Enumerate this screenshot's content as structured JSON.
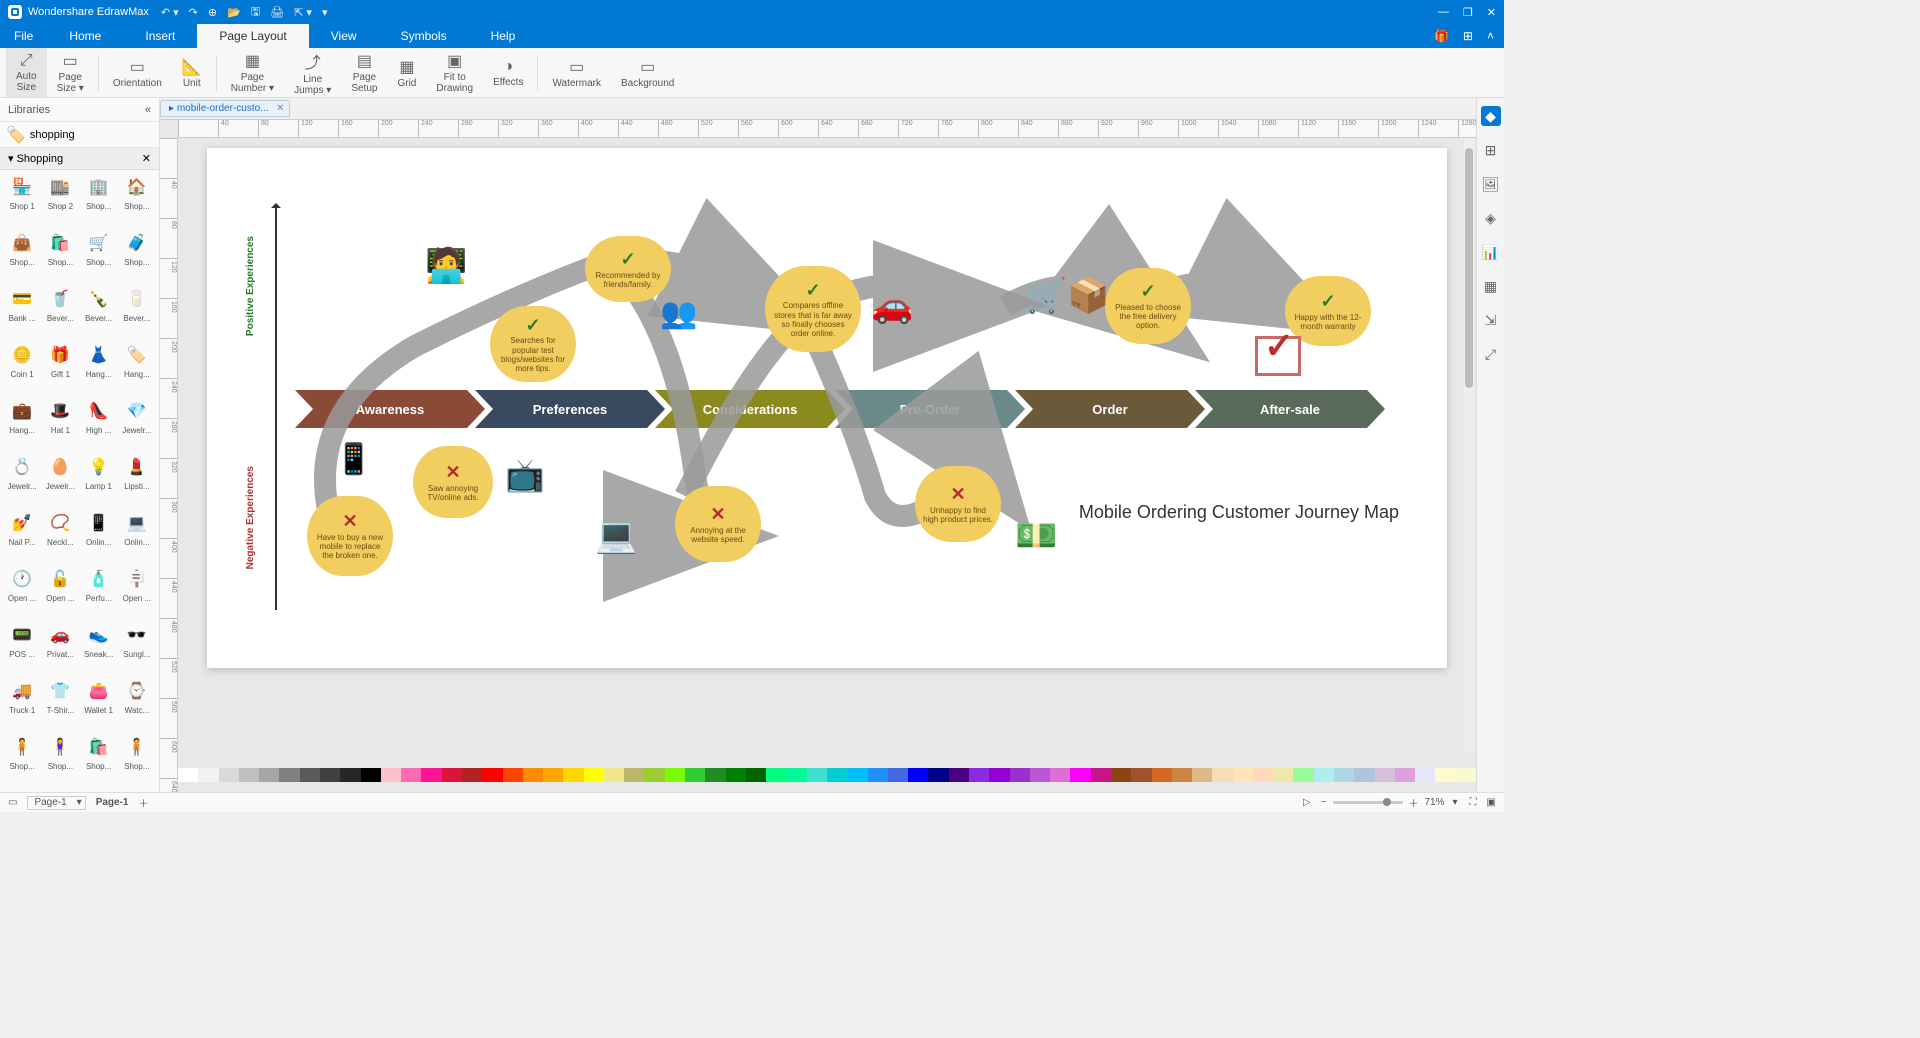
{
  "app": {
    "title": "Wondershare EdrawMax"
  },
  "menu": {
    "file": "File",
    "items": [
      "Home",
      "Insert",
      "Page Layout",
      "View",
      "Symbols",
      "Help"
    ],
    "active": 2
  },
  "ribbon": [
    {
      "label": "Auto\nSize",
      "icon": "⤢"
    },
    {
      "label": "Page\nSize ▾",
      "icon": "▭"
    },
    {
      "label": "Orientation",
      "icon": "▭"
    },
    {
      "label": "Unit",
      "icon": "▲"
    },
    {
      "label": "Page\nNumber ▾",
      "icon": "▦"
    },
    {
      "label": "Line\nJumps ▾",
      "icon": "⤴"
    },
    {
      "label": "Page\nSetup",
      "icon": "▤"
    },
    {
      "label": "Grid",
      "icon": "▦"
    },
    {
      "label": "Fit to\nDrawing",
      "icon": "▣"
    },
    {
      "label": "Effects",
      "icon": "◑"
    },
    {
      "label": "Watermark",
      "icon": "▭"
    },
    {
      "label": "Background",
      "icon": "▭"
    }
  ],
  "libraries": {
    "header": "Libraries",
    "search_value": "shopping",
    "category": "Shopping",
    "items": [
      {
        "l": "Shop 1",
        "e": "🏪"
      },
      {
        "l": "Shop 2",
        "e": "🏬"
      },
      {
        "l": "Shop...",
        "e": "🏢"
      },
      {
        "l": "Shop...",
        "e": "🏠"
      },
      {
        "l": "Shop...",
        "e": "👜"
      },
      {
        "l": "Shop...",
        "e": "🛍️"
      },
      {
        "l": "Shop...",
        "e": "🛒"
      },
      {
        "l": "Shop...",
        "e": "🧳"
      },
      {
        "l": "Bank ...",
        "e": "💳"
      },
      {
        "l": "Bever...",
        "e": "🥤"
      },
      {
        "l": "Bever...",
        "e": "🍾"
      },
      {
        "l": "Bever...",
        "e": "🥛"
      },
      {
        "l": "Coin 1",
        "e": "🪙"
      },
      {
        "l": "Gift 1",
        "e": "🎁"
      },
      {
        "l": "Hang...",
        "e": "👗"
      },
      {
        "l": "Hang...",
        "e": "🏷️"
      },
      {
        "l": "Hang...",
        "e": "💼"
      },
      {
        "l": "Hat 1",
        "e": "🎩"
      },
      {
        "l": "High ...",
        "e": "👠"
      },
      {
        "l": "Jewelr...",
        "e": "💎"
      },
      {
        "l": "Jewelr...",
        "e": "💍"
      },
      {
        "l": "Jewelr...",
        "e": "🥚"
      },
      {
        "l": "Lamp 1",
        "e": "💡"
      },
      {
        "l": "Lipsti...",
        "e": "💄"
      },
      {
        "l": "Nail P...",
        "e": "💅"
      },
      {
        "l": "Neckl...",
        "e": "📿"
      },
      {
        "l": "Onlin...",
        "e": "📱"
      },
      {
        "l": "Onlin...",
        "e": "💻"
      },
      {
        "l": "Open ...",
        "e": "🕐"
      },
      {
        "l": "Open ...",
        "e": "🔓"
      },
      {
        "l": "Perfu...",
        "e": "🧴"
      },
      {
        "l": "Open ...",
        "e": "🪧"
      },
      {
        "l": "POS ...",
        "e": "📟"
      },
      {
        "l": "Privat...",
        "e": "🚗"
      },
      {
        "l": "Sneak...",
        "e": "👟"
      },
      {
        "l": "Sungl...",
        "e": "🕶️"
      },
      {
        "l": "Truck 1",
        "e": "🚚"
      },
      {
        "l": "T-Shir...",
        "e": "👕"
      },
      {
        "l": "Wallet 1",
        "e": "👛"
      },
      {
        "l": "Watc...",
        "e": "⌚"
      },
      {
        "l": "Shop...",
        "e": "🧍"
      },
      {
        "l": "Shop...",
        "e": "🧍‍♀️"
      },
      {
        "l": "Shop...",
        "e": "🛍️"
      },
      {
        "l": "Shop...",
        "e": "🧍"
      }
    ]
  },
  "tab": {
    "name": "mobile-order-custo..."
  },
  "diagram": {
    "title": "Mobile Ordering Customer Journey Map",
    "axis_pos": "Positive\nExperiences",
    "axis_neg": "Negative\nExperiences",
    "stages": [
      {
        "label": "Awareness",
        "color": "#8a4a36"
      },
      {
        "label": "Preferences",
        "color": "#3a4a5e"
      },
      {
        "label": "Considerations",
        "color": "#8a8a1e"
      },
      {
        "label": "Pre-Order",
        "color": "#6a8a8a"
      },
      {
        "label": "Order",
        "color": "#6a5a3a"
      },
      {
        "label": "After-sale",
        "color": "#5a6a5a"
      }
    ],
    "pos_bubbles": [
      {
        "text": "Searches for popular test blogs/websites for more tips."
      },
      {
        "text": "Recommended by friends/family."
      },
      {
        "text": "Compares offline stores that is far away so finally chooses order online."
      },
      {
        "text": "Pleased to choose the free delivery option."
      },
      {
        "text": "Happy with the 12-month warranty"
      }
    ],
    "neg_bubbles": [
      {
        "text": "Have to buy a new mobile to replace the broken one."
      },
      {
        "text": "Saw annoying TV/online ads."
      },
      {
        "text": "Annoying at the website speed."
      },
      {
        "text": "Unhappy to find high product prices."
      }
    ]
  },
  "colors": [
    "#ffffff",
    "#f2f2f2",
    "#d9d9d9",
    "#bfbfbf",
    "#a6a6a6",
    "#808080",
    "#595959",
    "#404040",
    "#262626",
    "#000000",
    "#ffc0cb",
    "#ff69b4",
    "#ff1493",
    "#dc143c",
    "#b22222",
    "#ff0000",
    "#ff4500",
    "#ff8c00",
    "#ffa500",
    "#ffd700",
    "#ffff00",
    "#f0e68c",
    "#bdb76b",
    "#9acd32",
    "#7cfc00",
    "#32cd32",
    "#228b22",
    "#008000",
    "#006400",
    "#00ff7f",
    "#00fa9a",
    "#40e0d0",
    "#00ced1",
    "#00bfff",
    "#1e90ff",
    "#4169e1",
    "#0000ff",
    "#00008b",
    "#4b0082",
    "#8a2be2",
    "#9400d3",
    "#9932cc",
    "#ba55d3",
    "#da70d6",
    "#ff00ff",
    "#c71585",
    "#8b4513",
    "#a0522d",
    "#d2691e",
    "#cd853f",
    "#deb887",
    "#f5deb3",
    "#ffe4b5",
    "#ffdab9",
    "#eee8aa",
    "#98fb98",
    "#afeeee",
    "#add8e6",
    "#b0c4de",
    "#d8bfd8",
    "#dda0dd",
    "#e6e6fa",
    "#fffacd",
    "#fafad2"
  ],
  "status": {
    "page_sel": "Page-1",
    "page_tab": "Page-1",
    "zoom": "71%"
  }
}
